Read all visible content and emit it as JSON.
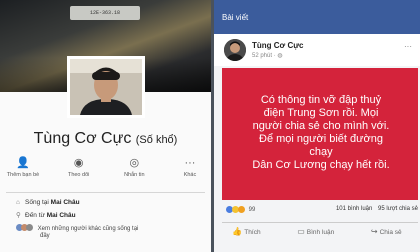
{
  "profile": {
    "plate_text": "12E-363.18",
    "name": "Tùng Cơ Cực",
    "nickname": "(Số khổ)",
    "actions": [
      {
        "icon": "add-friend-icon",
        "glyph": "👤",
        "label": "Thêm bạn bè"
      },
      {
        "icon": "follow-icon",
        "glyph": "◉",
        "label": "Theo dõi"
      },
      {
        "icon": "message-icon",
        "glyph": "◎",
        "label": "Nhắn tin"
      },
      {
        "icon": "more-icon",
        "glyph": "···",
        "label": "Khác"
      }
    ],
    "info": {
      "lives_prefix": "Sống tại ",
      "lives_place": "Mai Châu",
      "from_prefix": "Đến từ ",
      "from_place": "Mai Châu",
      "friends_line1": "Xem những người khác cũng sống tại",
      "friends_line2": "đây"
    }
  },
  "post": {
    "header": "Bài viết",
    "author": "Tùng Cơ Cực",
    "time": "52 phút",
    "text_lines": [
      "Có thông tin vỡ đập thuỷ",
      "điện Trung Sơn rồi. Mọi",
      "người chia sẻ cho mình với.",
      "Để mọi người biết đường",
      "chạy",
      "Dân Cơ Lương chạy hết rồi."
    ],
    "reactions_count": "99",
    "comments": "101 bình luận",
    "shares": "95 lượt chia sẻ",
    "buttons": {
      "like": "Thích",
      "comment": "Bình luận",
      "share": "Chia sẻ"
    }
  },
  "colors": {
    "post_bg": "#d4233b",
    "facebook_blue": "#3b5c9c"
  }
}
